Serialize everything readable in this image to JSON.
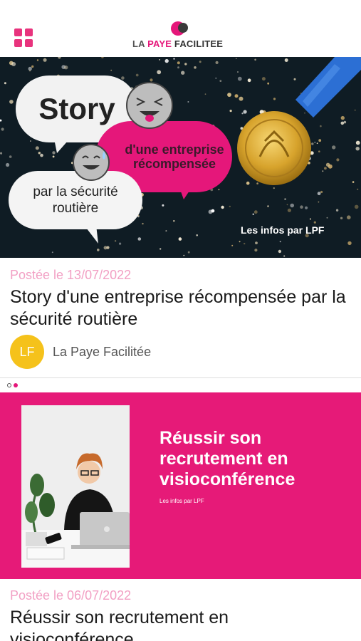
{
  "header": {
    "logo": {
      "la": "LA",
      "paye": "PAYE",
      "facilitee": "FACILITEE"
    },
    "menu_icon": "grid-menu-icon",
    "accent": "#e5177a"
  },
  "posts": [
    {
      "image": {
        "story": "Story",
        "pink_text": "d'une entreprise récompensée",
        "white_text_line1": "par la sécurité",
        "white_text_line2": "routière",
        "caption": "Les infos par LPF"
      },
      "date": "Postée le 13/07/2022",
      "title": "Story d'une entreprise récompensée par la sécurité routière",
      "author": {
        "initials": "LF",
        "name": "La Paye Facilitée"
      }
    },
    {
      "image": {
        "title": "Réussir son recrutement en visioconférence",
        "caption": "Les infos par LPF"
      },
      "date": "Postée le 06/07/2022",
      "title": "Réussir son recrutement en visioconférence"
    }
  ]
}
